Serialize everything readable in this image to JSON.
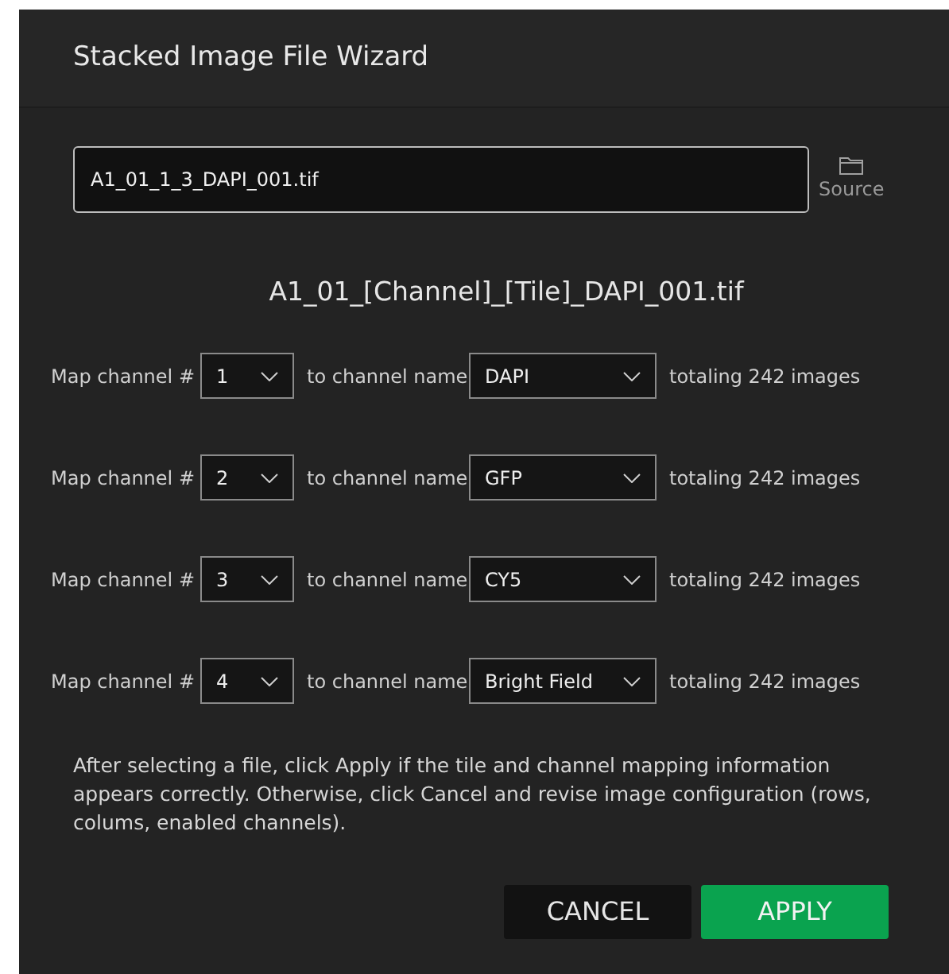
{
  "window": {
    "title": "Stacked Image File Wizard"
  },
  "file_field": {
    "value": "A1_01_1_3_DAPI_001.tif"
  },
  "source_button": {
    "label": "Source"
  },
  "pattern": "A1_01_[Channel]_[Tile]_DAPI_001.tif",
  "mappings": [
    {
      "label": "Map channel #",
      "channel": "1",
      "connector": "to channel name",
      "name": "DAPI",
      "total": "totaling 242 images"
    },
    {
      "label": "Map channel #",
      "channel": "2",
      "connector": "to channel name",
      "name": "GFP",
      "total": "totaling 242 images"
    },
    {
      "label": "Map channel #",
      "channel": "3",
      "connector": "to channel name",
      "name": "CY5",
      "total": "totaling 242 images"
    },
    {
      "label": "Map channel #",
      "channel": "4",
      "connector": "to channel name",
      "name": "Bright Field",
      "total": "totaling 242 images"
    }
  ],
  "instructions": "After selecting a file, click Apply if the tile and channel mapping information appears correctly. Otherwise, click Cancel and revise image configuration (rows, colums, enabled channels).",
  "buttons": [
    {
      "label": "CANCEL",
      "kind": "secondary"
    },
    {
      "label": "APPLY",
      "kind": "primary"
    }
  ]
}
